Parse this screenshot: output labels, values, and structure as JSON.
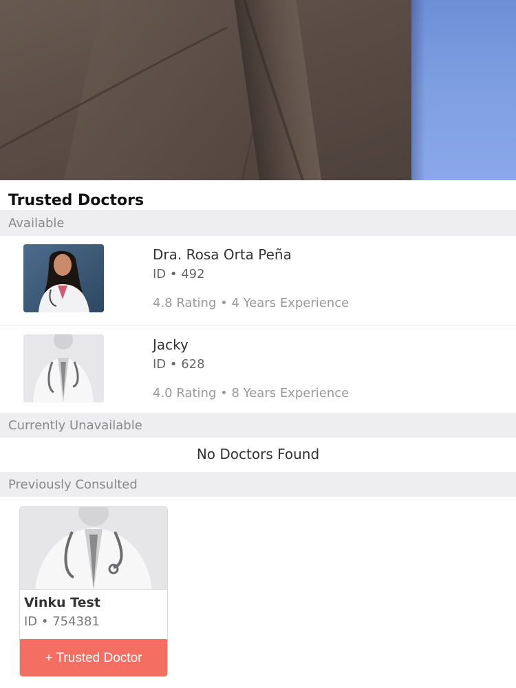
{
  "page": {
    "title": "Trusted Doctors"
  },
  "sections": {
    "available": {
      "label": "Available",
      "doctors": [
        {
          "name": "Dra. Rosa Orta Peña",
          "id_text": "ID • 492",
          "meta": "4.8 Rating • 4 Years Experience",
          "photo": "doctor-female-photo"
        },
        {
          "name": "Jacky",
          "id_text": "ID • 628",
          "meta": "4.0 Rating • 8 Years Experience",
          "photo": "doctor-placeholder-icon"
        }
      ]
    },
    "unavailable": {
      "label": "Currently Unavailable",
      "empty_text": "No Doctors Found"
    },
    "previous": {
      "label": "Previously Consulted",
      "cards": [
        {
          "name": "Vinku Test",
          "id_text": "ID • 754381",
          "button_label": "+ Trusted Doctor",
          "photo": "doctor-placeholder-icon"
        }
      ]
    }
  },
  "colors": {
    "accent": "#f46f61",
    "section_bg": "#eeeef0",
    "muted_text": "#999999"
  }
}
